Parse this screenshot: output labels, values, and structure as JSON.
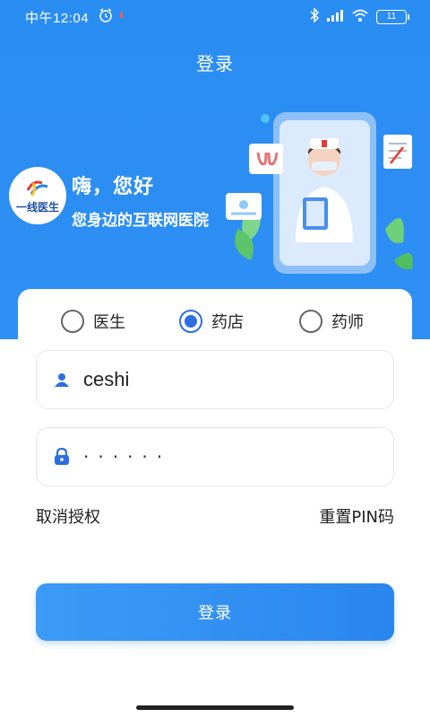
{
  "status_bar": {
    "time": "中午12:04",
    "battery": "11"
  },
  "header": {
    "title": "登录"
  },
  "hero": {
    "logo_text": "一线医生",
    "greeting": "嗨，您好",
    "subtitle": "您身边的互联网医院"
  },
  "roles": [
    {
      "label": "医生",
      "selected": false
    },
    {
      "label": "药店",
      "selected": true
    },
    {
      "label": "药师",
      "selected": false
    }
  ],
  "form": {
    "username": "ceshi",
    "password_mask": "······",
    "cancel_auth_label": "取消授权",
    "reset_pin_label": "重置PIN码",
    "login_label": "登录"
  },
  "colors": {
    "brand_blue": "#2e8ff4",
    "radio_selected": "#2e6fe0"
  }
}
